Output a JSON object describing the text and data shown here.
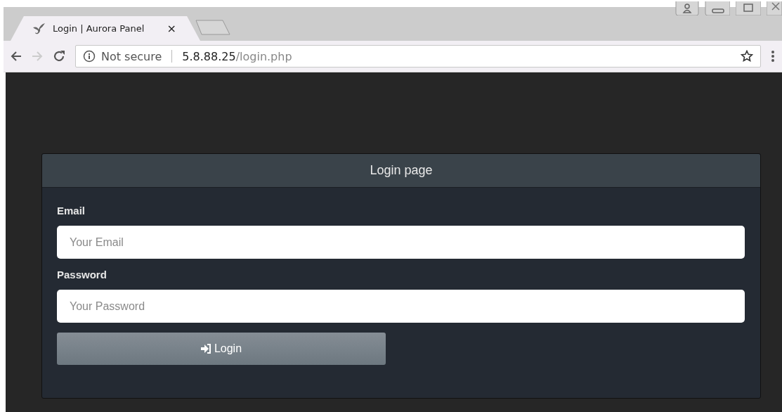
{
  "browser": {
    "tabs": [
      {
        "title": "Login | Aurora Panel",
        "close": "×",
        "selected": true
      }
    ],
    "navigation": {
      "forward_disabled": true
    },
    "address": {
      "security": "Not secure",
      "host": "5.8.88.25",
      "path": "/login.php"
    }
  },
  "card": {
    "title": "Login page",
    "fields": [
      {
        "label": "Email",
        "placeholder": "Your Email"
      },
      {
        "label": "Password",
        "placeholder": "Your Password"
      }
    ],
    "button": "Login"
  }
}
